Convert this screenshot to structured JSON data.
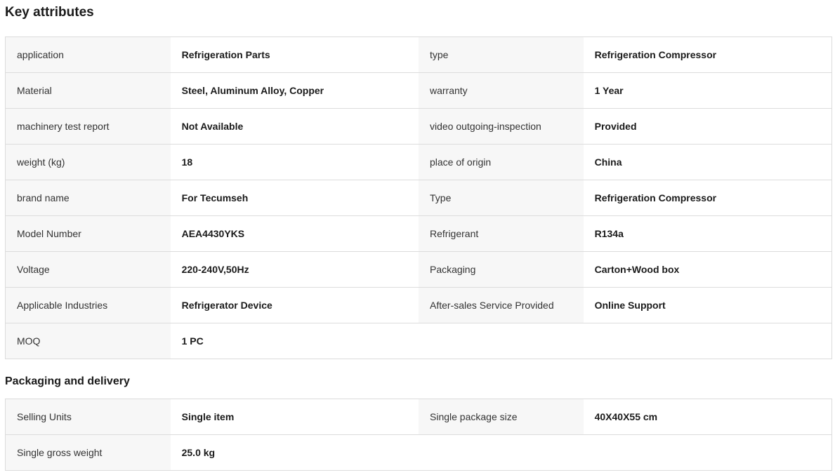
{
  "key_attributes": {
    "title": "Key attributes",
    "rows": [
      {
        "l1": "application",
        "v1": "Refrigeration Parts",
        "l2": "type",
        "v2": "Refrigeration Compressor"
      },
      {
        "l1": "Material",
        "v1": "Steel, Aluminum Alloy, Copper",
        "l2": "warranty",
        "v2": "1 Year"
      },
      {
        "l1": "machinery test report",
        "v1": "Not Available",
        "l2": "video outgoing-inspection",
        "v2": "Provided"
      },
      {
        "l1": "weight (kg)",
        "v1": "18",
        "l2": "place of origin",
        "v2": "China"
      },
      {
        "l1": "brand name",
        "v1": "For Tecumseh",
        "l2": "Type",
        "v2": "Refrigeration Compressor"
      },
      {
        "l1": "Model Number",
        "v1": "AEA4430YKS",
        "l2": "Refrigerant",
        "v2": "R134a"
      },
      {
        "l1": "Voltage",
        "v1": "220-240V,50Hz",
        "l2": "Packaging",
        "v2": "Carton+Wood box"
      },
      {
        "l1": "Applicable Industries",
        "v1": "Refrigerator Device",
        "l2": "After-sales Service Provided",
        "v2": "Online Support"
      },
      {
        "l1": "MOQ",
        "v1": "1 PC"
      }
    ]
  },
  "packaging_delivery": {
    "title": "Packaging and delivery",
    "rows": [
      {
        "l1": "Selling Units",
        "v1": "Single item",
        "l2": "Single package size",
        "v2": "40X40X55 cm"
      },
      {
        "l1": "Single gross weight",
        "v1": "25.0 kg"
      }
    ]
  }
}
